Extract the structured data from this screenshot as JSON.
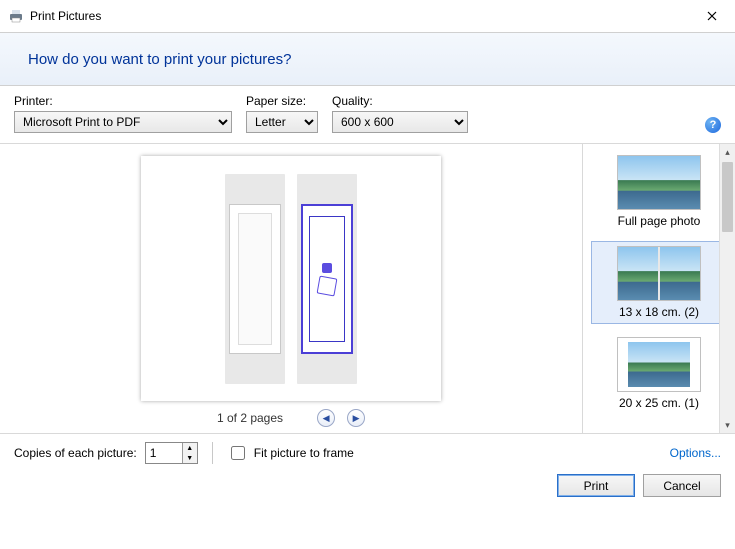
{
  "window": {
    "title": "Print Pictures",
    "heading": "How do you want to print your pictures?"
  },
  "controls": {
    "printer_label": "Printer:",
    "printer_value": "Microsoft Print to PDF",
    "paper_label": "Paper size:",
    "paper_value": "Letter",
    "quality_label": "Quality:",
    "quality_value": "600 x 600"
  },
  "pager": {
    "text": "1 of 2 pages"
  },
  "layouts": {
    "full": "Full page photo",
    "l13x18": "13 x 18 cm. (2)",
    "l20x25": "20 x 25 cm. (1)",
    "selected": "l13x18"
  },
  "footer": {
    "copies_label": "Copies of each picture:",
    "copies_value": "1",
    "fit_label": "Fit picture to frame",
    "fit_checked": false,
    "options_link": "Options...",
    "print_btn": "Print",
    "cancel_btn": "Cancel"
  }
}
